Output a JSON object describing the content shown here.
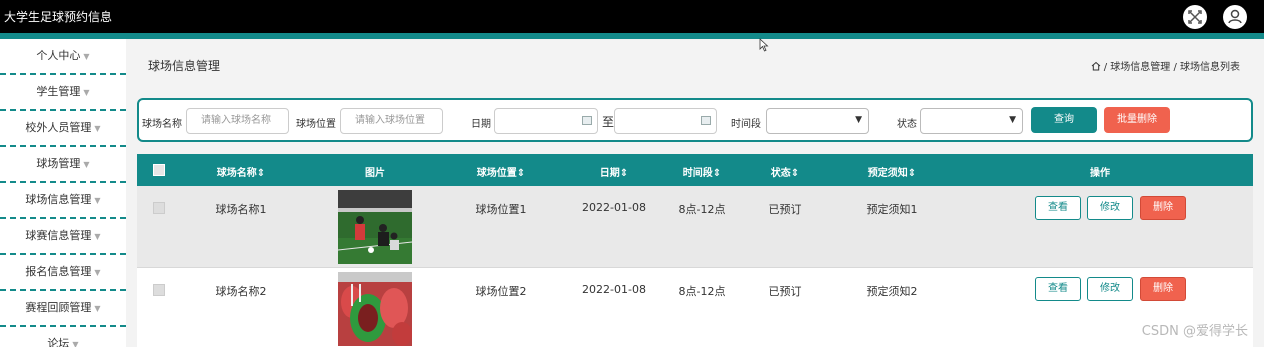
{
  "app": {
    "title": "大学生足球预约信息"
  },
  "topbar": {
    "fullscreen_icon": "fullscreen-icon",
    "user_icon": "user-icon"
  },
  "sidebar": {
    "items": [
      {
        "label": "个人中心"
      },
      {
        "label": "学生管理"
      },
      {
        "label": "校外人员管理"
      },
      {
        "label": "球场管理"
      },
      {
        "label": "球场信息管理"
      },
      {
        "label": "球赛信息管理"
      },
      {
        "label": "报名信息管理"
      },
      {
        "label": "赛程回顾管理"
      },
      {
        "label": "论坛"
      }
    ],
    "caret": "▼"
  },
  "page": {
    "title": "球场信息管理",
    "breadcrumb": {
      "sep": "/",
      "level1": "球场信息管理",
      "level2": "球场信息列表"
    }
  },
  "search": {
    "name_label": "球场名称",
    "name_placeholder": "请输入球场名称",
    "location_label": "球场位置",
    "location_placeholder": "请输入球场位置",
    "date_label": "日期",
    "date_to": "至",
    "timeslot_label": "时间段",
    "status_label": "状态",
    "query_button": "查询",
    "batch_delete_button": "批量删除"
  },
  "table": {
    "headers": {
      "name": "球场名称",
      "image": "图片",
      "location": "球场位置",
      "date": "日期",
      "timeslot": "时间段",
      "status": "状态",
      "notice": "预定须知",
      "actions": "操作"
    },
    "rows": [
      {
        "name": "球场名称1",
        "location": "球场位置1",
        "date": "2022-01-08",
        "timeslot": "8点-12点",
        "status": "已预订",
        "notice": "预定须知1"
      },
      {
        "name": "球场名称2",
        "location": "球场位置2",
        "date": "2022-01-08",
        "timeslot": "8点-12点",
        "status": "已预订",
        "notice": "预定须知2"
      }
    ],
    "actions": {
      "view": "查看",
      "edit": "修改",
      "delete": "删除"
    }
  },
  "watermark": "CSDN @爱得学长",
  "colors": {
    "teal": "#138a8a",
    "danger": "#f0624e",
    "header_bg": "#000000"
  }
}
